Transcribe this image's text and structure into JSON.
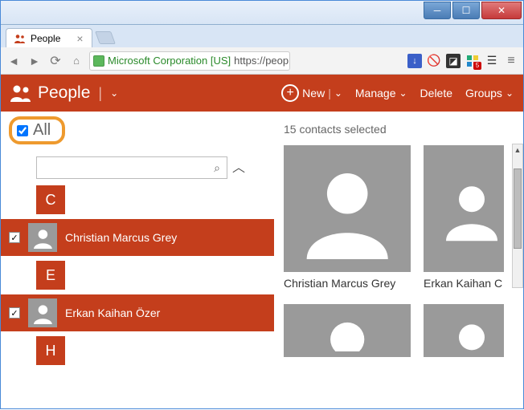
{
  "window": {
    "tab_title": "People",
    "ev_cert": "Microsoft Corporation [US]",
    "url_text": "https://peop",
    "ext_badge": "5"
  },
  "header": {
    "app_name": "People",
    "new_label": "New",
    "manage_label": "Manage",
    "delete_label": "Delete",
    "groups_label": "Groups"
  },
  "left": {
    "all_label": "All",
    "search_placeholder": "",
    "letters": [
      "C",
      "E",
      "H"
    ],
    "contacts": [
      {
        "name": "Christian Marcus Grey",
        "checked": true
      },
      {
        "name": "Erkan Kaihan Özer",
        "checked": true
      }
    ]
  },
  "right": {
    "status": "15 contacts selected",
    "cards": [
      {
        "name": "Christian Marcus Grey"
      },
      {
        "name": "Erkan Kaihan C"
      }
    ]
  }
}
